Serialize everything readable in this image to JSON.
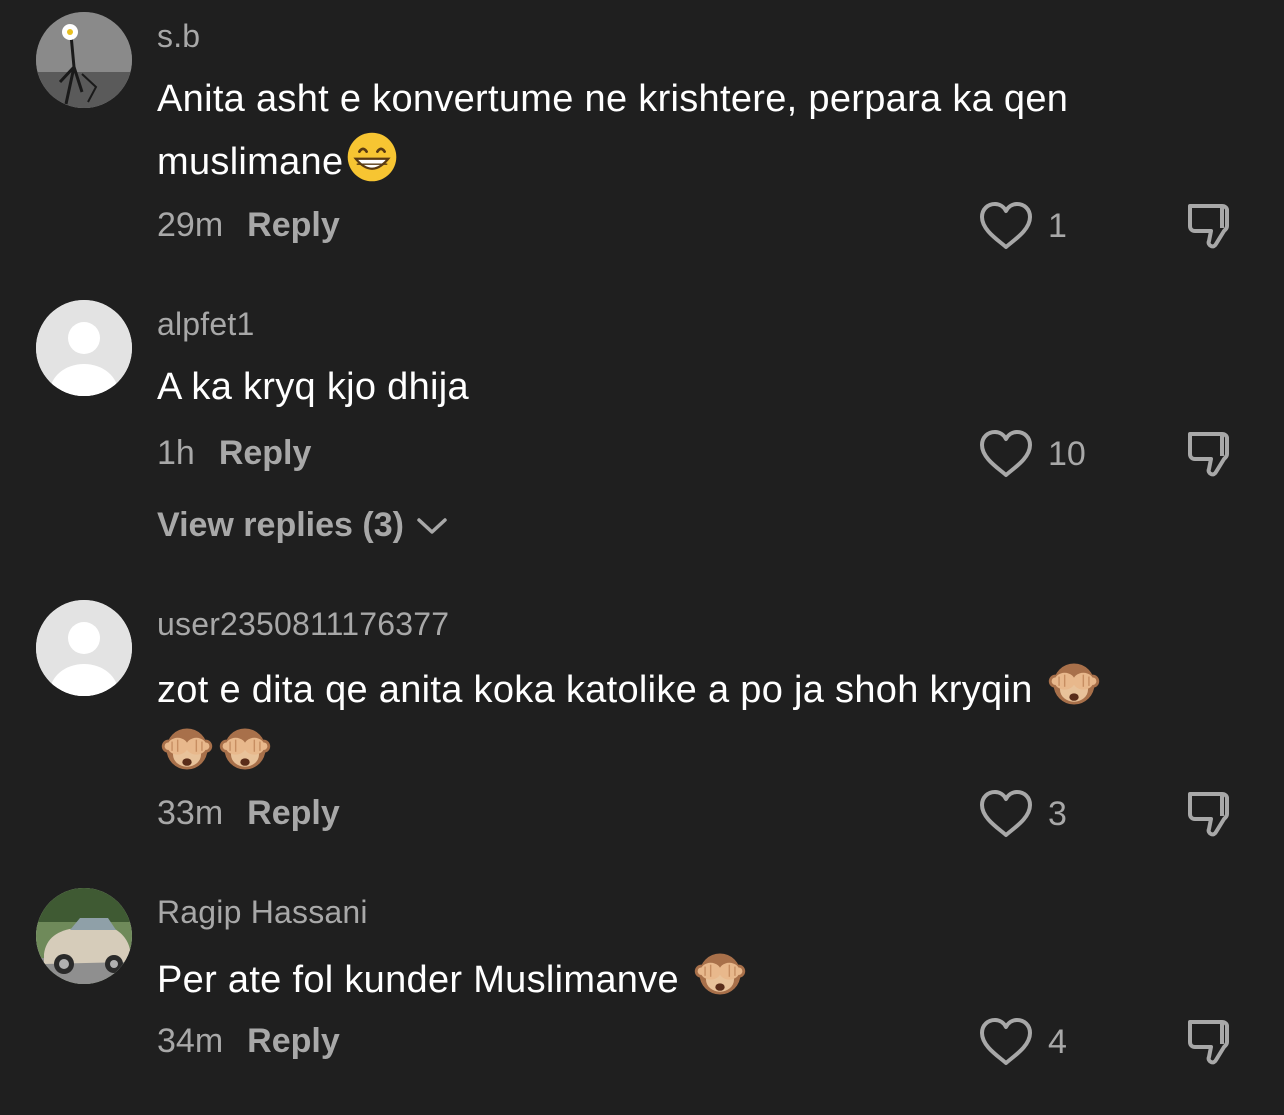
{
  "comments": [
    {
      "username": "s.b",
      "text": "Anita asht e konvertume ne krishtere, perpara ka qen muslimane",
      "emoji": "grinning-face",
      "time": "29m",
      "reply_label": "Reply",
      "likes": "1",
      "avatar": "flower-photo"
    },
    {
      "username": "alpfet1",
      "text": "A ka kryq kjo dhija",
      "time": "1h",
      "reply_label": "Reply",
      "likes": "10",
      "avatar": "default-avatar",
      "view_replies": "View replies (3)"
    },
    {
      "username": "user2350811176377",
      "text": "zot e dita qe anita koka katolike a po ja shoh kryqin",
      "emoji": "see-no-evil-monkey x3",
      "time": "33m",
      "reply_label": "Reply",
      "likes": "3",
      "avatar": "default-avatar"
    },
    {
      "username": "Ragip Hassani",
      "text": "Per ate fol kunder Muslimanve",
      "emoji": "see-no-evil-monkey",
      "time": "34m",
      "reply_label": "Reply",
      "likes": "4",
      "avatar": "car-photo"
    }
  ],
  "colors": {
    "background": "#1f1f1f",
    "muted_text": "#a8a8a8",
    "primary_text": "#ffffff"
  }
}
